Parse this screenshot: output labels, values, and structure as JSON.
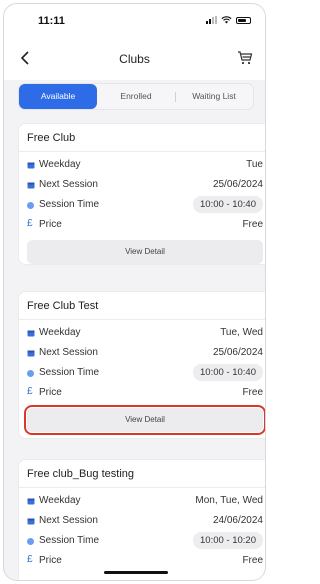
{
  "status_bar": {
    "time": "11:11"
  },
  "nav": {
    "title": "Clubs"
  },
  "tabs": [
    {
      "label": "Available",
      "active": true
    },
    {
      "label": "Enrolled",
      "active": false
    },
    {
      "label": "Waiting List",
      "active": false
    }
  ],
  "cards": [
    {
      "title": "Free Club",
      "weekday_label": "Weekday",
      "weekday": "Tue",
      "next_session_label": "Next Session",
      "next_session": "25/06/2024",
      "session_time_label": "Session Time",
      "session_time": "10:00 - 10:40",
      "price_label": "Price",
      "price": "Free",
      "button": "View Detail"
    },
    {
      "title": "Free Club Test",
      "weekday_label": "Weekday",
      "weekday": "Tue, Wed",
      "next_session_label": "Next Session",
      "next_session": "25/06/2024",
      "session_time_label": "Session Time",
      "session_time": "10:00 - 10:40",
      "price_label": "Price",
      "price": "Free",
      "button": "View Detail"
    },
    {
      "title": "Free club_Bug testing",
      "weekday_label": "Weekday",
      "weekday": "Mon, Tue, Wed",
      "next_session_label": "Next Session",
      "next_session": "24/06/2024",
      "session_time_label": "Session Time",
      "session_time": "10:00 - 10:20",
      "price_label": "Price",
      "price": "Free"
    }
  ],
  "colors": {
    "accent": "#2e6be6",
    "highlight": "#d9382a"
  },
  "icons": {
    "back": "chevron-left-icon",
    "cart": "cart-icon",
    "calendar": "calendar-icon",
    "clock": "clock-icon",
    "currency": "pound-icon"
  }
}
